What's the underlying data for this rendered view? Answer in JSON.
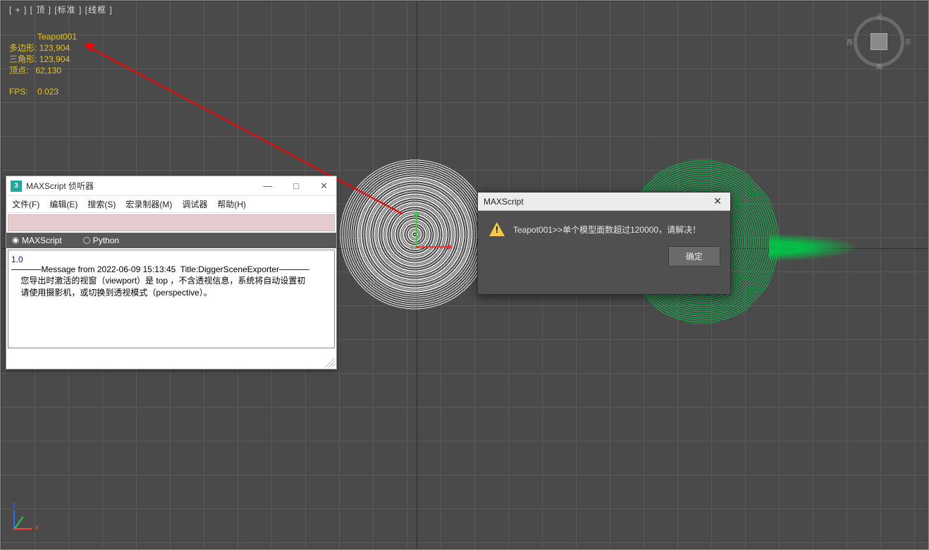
{
  "viewport": {
    "label": "[ + ]  [ 顶 ]  [标准 ]  [线框 ]"
  },
  "stats": {
    "object_name": "Teapot001",
    "poly_label": "多边形:",
    "poly_value": "123,904",
    "tri_label": "三角形:",
    "tri_value": "123,904",
    "vert_label": "顶点:",
    "vert_value": "62,130",
    "fps_label": "FPS:",
    "fps_value": "0.023"
  },
  "viewcube": {
    "n": "北",
    "s": "南",
    "e": "东",
    "w": "西"
  },
  "listener": {
    "title": "MAXScript 侦听器",
    "menu": {
      "file": "文件(F)",
      "edit": "编辑(E)",
      "search": "搜索(S)",
      "macro": "宏录制器(M)",
      "debugger": "调试器",
      "help": "帮助(H)"
    },
    "radios": {
      "maxscript": "MAXScript",
      "python": "Python"
    },
    "console": {
      "line1": "1.0",
      "line2": "─────Message from 2022-06-09 15:13:45  Title:DiggerSceneExporter─────",
      "line3": "    您导出时激活的视窗（viewport）是 top ，不含透视信息，系统将自动设置初",
      "line4": "    请使用摄影机，或切换到透视模式（perspective）。"
    }
  },
  "alert": {
    "title": "MAXScript",
    "message": "Teapot001>>单个模型面数超过120000，请解决！",
    "ok": "确定"
  }
}
